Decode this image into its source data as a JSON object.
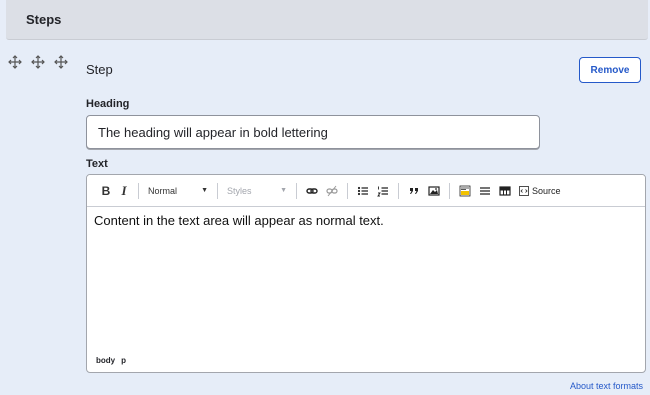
{
  "section": {
    "title": "Steps"
  },
  "step": {
    "label": "Step",
    "remove_label": "Remove",
    "heading": {
      "label": "Heading",
      "value": "The heading will appear in bold lettering"
    },
    "text": {
      "label": "Text",
      "content": "Content in the text area will appear as normal text.",
      "toolbar": {
        "bold": "B",
        "italic": "I",
        "format_select": "Normal",
        "styles_select": "Styles",
        "source_label": "Source",
        "icons": [
          "link-icon",
          "unlink-icon",
          "bulleted-list-icon",
          "numbered-list-icon",
          "blockquote-icon",
          "image-icon",
          "code-block-icon",
          "horizontal-line-icon",
          "table-icon",
          "source-icon"
        ]
      },
      "path": [
        "body",
        "p"
      ]
    }
  },
  "about_formats_link": "About text formats",
  "colors": {
    "accent": "#2559c9",
    "row_background": "#e6edf8",
    "header_background": "#dcdfe6"
  }
}
